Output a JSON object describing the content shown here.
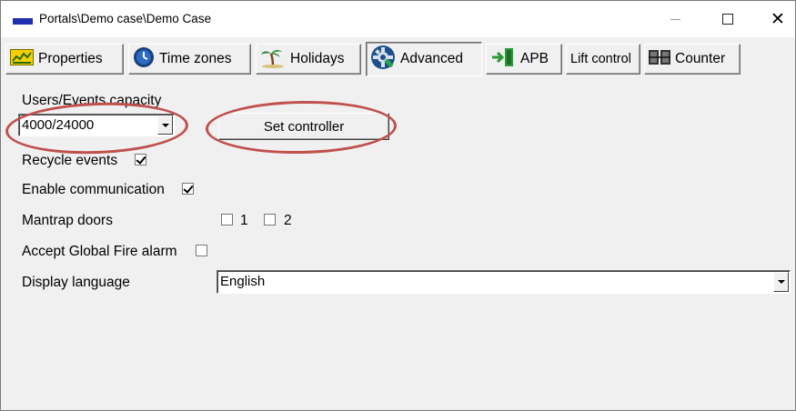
{
  "window": {
    "title": "Portals\\Demo case\\Demo Case",
    "controls": {
      "minimize": "minimize",
      "maximize": "maximize",
      "close": "close"
    }
  },
  "tabs": [
    {
      "label": "Properties",
      "icon": "properties-icon"
    },
    {
      "label": "Time zones",
      "icon": "clock-icon"
    },
    {
      "label": "Holidays",
      "icon": "palm-tree-icon"
    },
    {
      "label": "Advanced",
      "icon": "gear-icon",
      "active": true
    },
    {
      "label": "APB",
      "icon": "door-exit-icon"
    },
    {
      "label": "Lift control",
      "icon": ""
    },
    {
      "label": "Counter",
      "icon": "counter-icon"
    }
  ],
  "advanced": {
    "capacity_label": "Users/Events capacity",
    "capacity_value": "4000/24000",
    "set_controller_label": "Set controller",
    "recycle_events_label": "Recycle events",
    "recycle_events_checked": true,
    "enable_communication_label": "Enable communication",
    "enable_communication_checked": true,
    "mantrap_label": "Mantrap doors",
    "mantrap_options": [
      {
        "label": "1",
        "checked": false
      },
      {
        "label": "2",
        "checked": false
      }
    ],
    "fire_alarm_label": "Accept Global Fire alarm",
    "fire_alarm_checked": false,
    "language_label": "Display language",
    "language_value": "English"
  },
  "colors": {
    "highlight_oval": "#c0504d",
    "app_icon": "#1f2fb0"
  }
}
